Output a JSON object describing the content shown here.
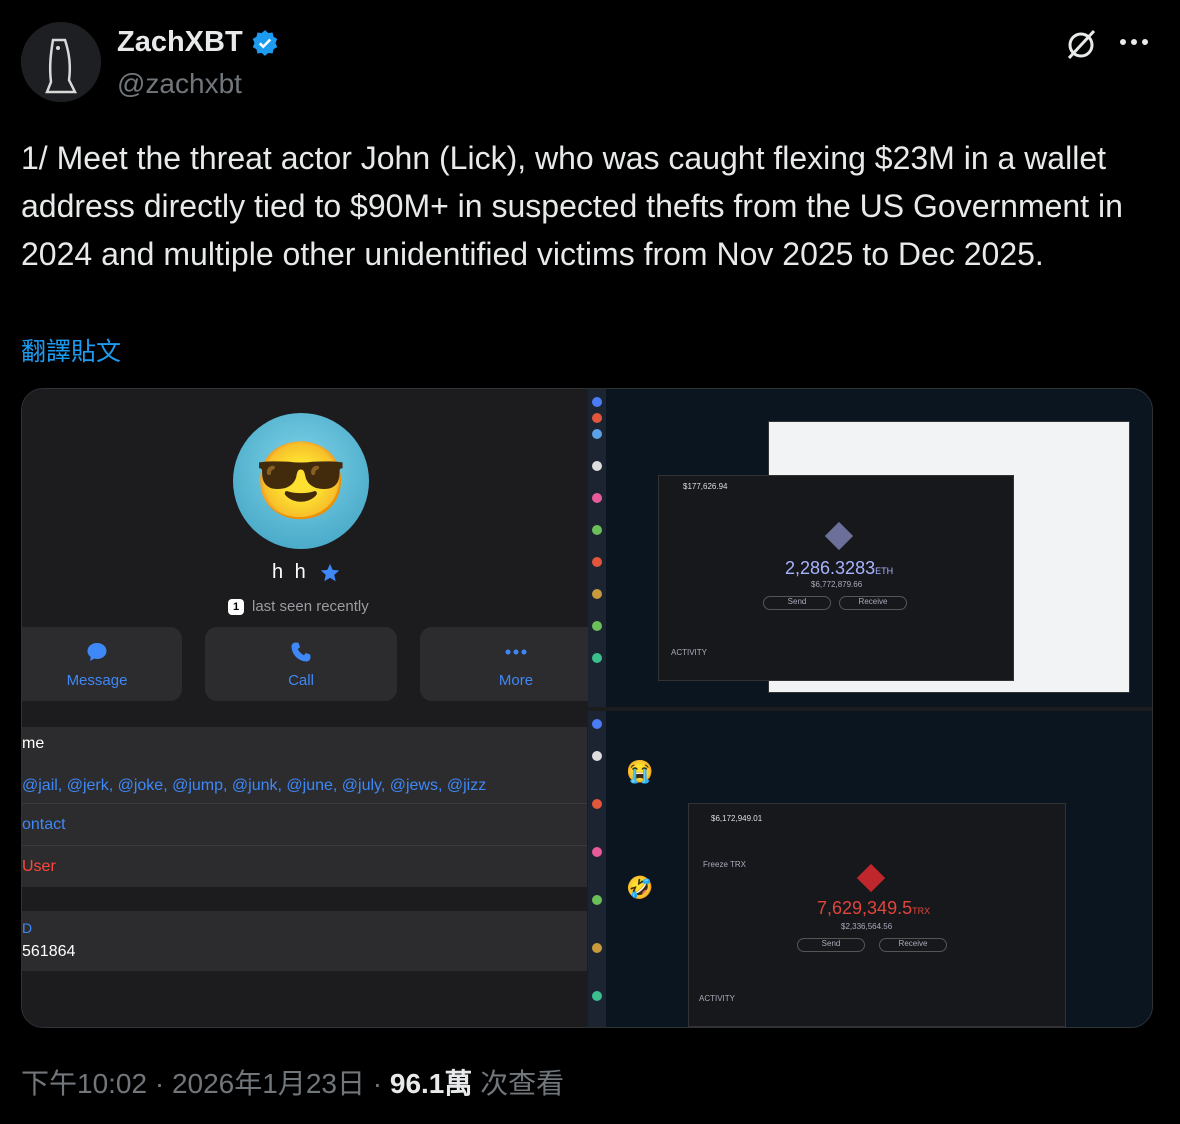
{
  "author": {
    "name": "ZachXBT",
    "handle": "@zachxbt",
    "verified_color": "#1d9bf0"
  },
  "icons": {
    "grok": "slashed-circle-icon",
    "more": "more-dots-icon",
    "verified": "verified-badge-icon"
  },
  "tweet": {
    "text": "1/ Meet the threat actor John (Lick), who was caught flexing $23M in a wallet address directly tied to $90M+  in suspected thefts from the US Government in 2024 and multiple other unidentified victims from Nov 2025 to Dec 2025.",
    "translate_label": "翻譯貼文"
  },
  "media": {
    "profile": {
      "name": "h h",
      "seen_badge": "1",
      "last_seen": "last seen recently",
      "buttons": [
        {
          "label": "Message"
        },
        {
          "label": "Call"
        },
        {
          "label": "More"
        }
      ],
      "rows": {
        "username_label": "me",
        "usernames": "@jail, @jerk, @joke, @jump, @junk, @june, @july, @jews, @jizz",
        "contact": "ontact",
        "user": "User",
        "id_label": "D",
        "id_value": "561864"
      }
    },
    "wallet1": {
      "balance": "2,286.3283",
      "unit": "ETH",
      "usd": "$6,772,879.66",
      "total": "$177,626.94",
      "send": "Send",
      "receive": "Receive",
      "activity": "ACTIVITY"
    },
    "wallet2": {
      "balance": "7,629,349.5",
      "unit": "TRX",
      "usd": "$2,336,564.56",
      "total": "$6,172,949.01",
      "send": "Send",
      "receive": "Receive",
      "freeze": "Freeze TRX",
      "activity": "ACTIVITY"
    }
  },
  "footer": {
    "time": "下午10:02",
    "date": "2026年1月23日",
    "views": "96.1萬",
    "views_label": "次查看"
  }
}
